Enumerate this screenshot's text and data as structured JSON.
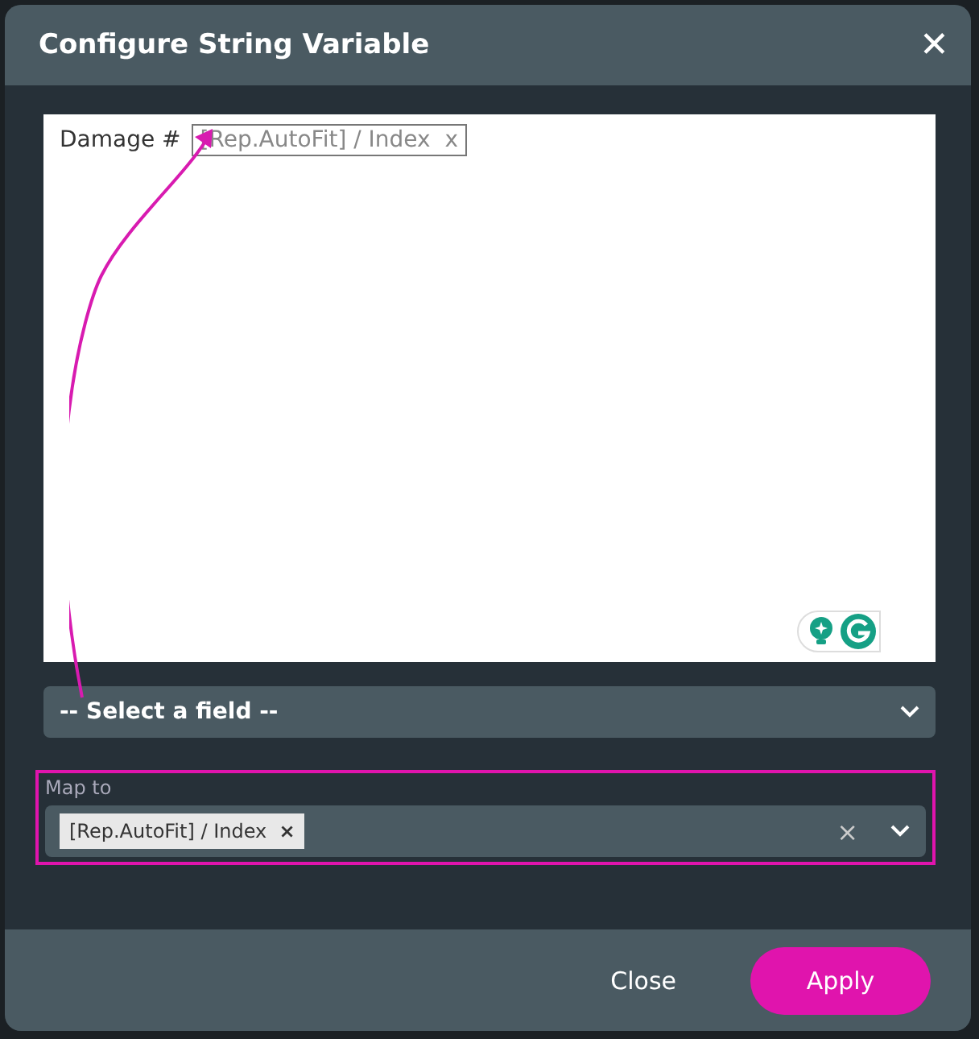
{
  "window": {
    "title": "Configure String Variable",
    "close": "✕"
  },
  "editor": {
    "label": "Damage #",
    "token": {
      "text": "[Rep.AutoFit] / Index",
      "remove": "x"
    }
  },
  "field_select": {
    "placeholder": "-- Select a field --"
  },
  "map_to": {
    "label": "Map to",
    "highlighted": true,
    "tags": [
      {
        "text": "[Rep.AutoFit] / Index",
        "remove": "×"
      }
    ],
    "clear": "×"
  },
  "buttons": [
    {
      "label": "Close",
      "kind": "text"
    },
    {
      "label": "Apply",
      "kind": "primary"
    }
  ]
}
